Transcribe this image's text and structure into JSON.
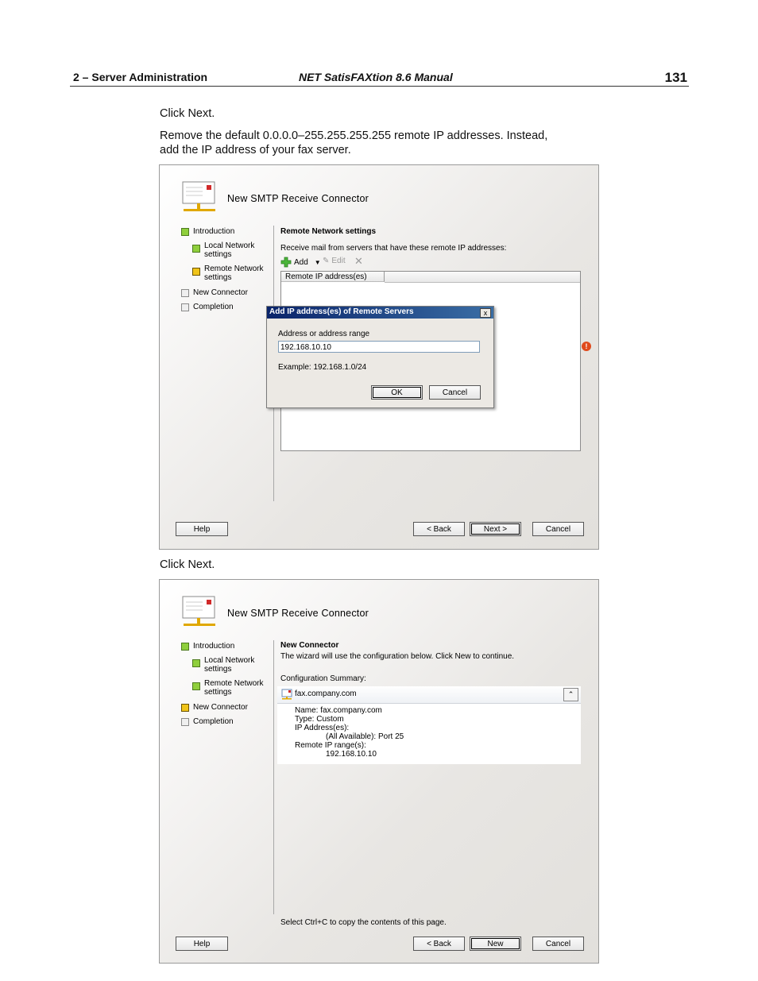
{
  "header": {
    "section": "2  – Server Administration",
    "manual_title": "NET SatisFAXtion 8.6 Manual",
    "page_number": "131"
  },
  "paragraphs": {
    "p1": "Click Next.",
    "p2_line1": "Remove the default 0.0.0.0–255.255.255.255 remote IP addresses. Instead,",
    "p2_line2": "add the IP address of your fax server.",
    "p3": "Click Next."
  },
  "wizard1": {
    "title": "New SMTP Receive Connector",
    "nav": [
      {
        "label": "Introduction",
        "status": "complete"
      },
      {
        "label": "Local Network",
        "label2": "settings",
        "status": "complete"
      },
      {
        "label": "Remote Network",
        "label2": "settings",
        "status": "current"
      },
      {
        "label": "New Connector",
        "status": "pending"
      },
      {
        "label": "Completion",
        "status": "pending"
      }
    ],
    "section_title": "Remote Network settings",
    "description": "Receive mail from servers that have these remote IP addresses:",
    "toolbar": {
      "add": "Add",
      "edit": "Edit"
    },
    "column_header": "Remote IP address(es)",
    "buttons": {
      "help": "Help",
      "back": "< Back",
      "next": "Next >",
      "cancel": "Cancel"
    },
    "dialog": {
      "title": "Add IP address(es) of Remote Servers",
      "close": "x",
      "field_label": "Address or address range",
      "field_value": "192.168.10.10",
      "example": "Example: 192.168.1.0/24",
      "ok": "OK",
      "cancel": "Cancel"
    },
    "warning_glyph": "!"
  },
  "wizard2": {
    "title": "New SMTP Receive Connector",
    "nav": [
      {
        "label": "Introduction",
        "status": "complete"
      },
      {
        "label": "Local Network",
        "label2": "settings",
        "status": "complete"
      },
      {
        "label": "Remote Network",
        "label2": "settings",
        "status": "complete"
      },
      {
        "label": "New Connector",
        "status": "current"
      },
      {
        "label": "Completion",
        "status": "pending"
      }
    ],
    "section_title": "New Connector",
    "description": "The wizard will use the configuration below.  Click New to continue.",
    "summary_label": "Configuration Summary:",
    "summary_item": "fax.company.com",
    "summary_lines": [
      "Name: fax.company.com",
      "Type: Custom",
      "IP Address(es):",
      "(All Available): Port 25",
      "Remote IP range(s):",
      "192.168.10.10"
    ],
    "footer_note": "Select Ctrl+C to copy the contents of this page.",
    "buttons": {
      "help": "Help",
      "back": "< Back",
      "new": "New",
      "cancel": "Cancel"
    }
  }
}
